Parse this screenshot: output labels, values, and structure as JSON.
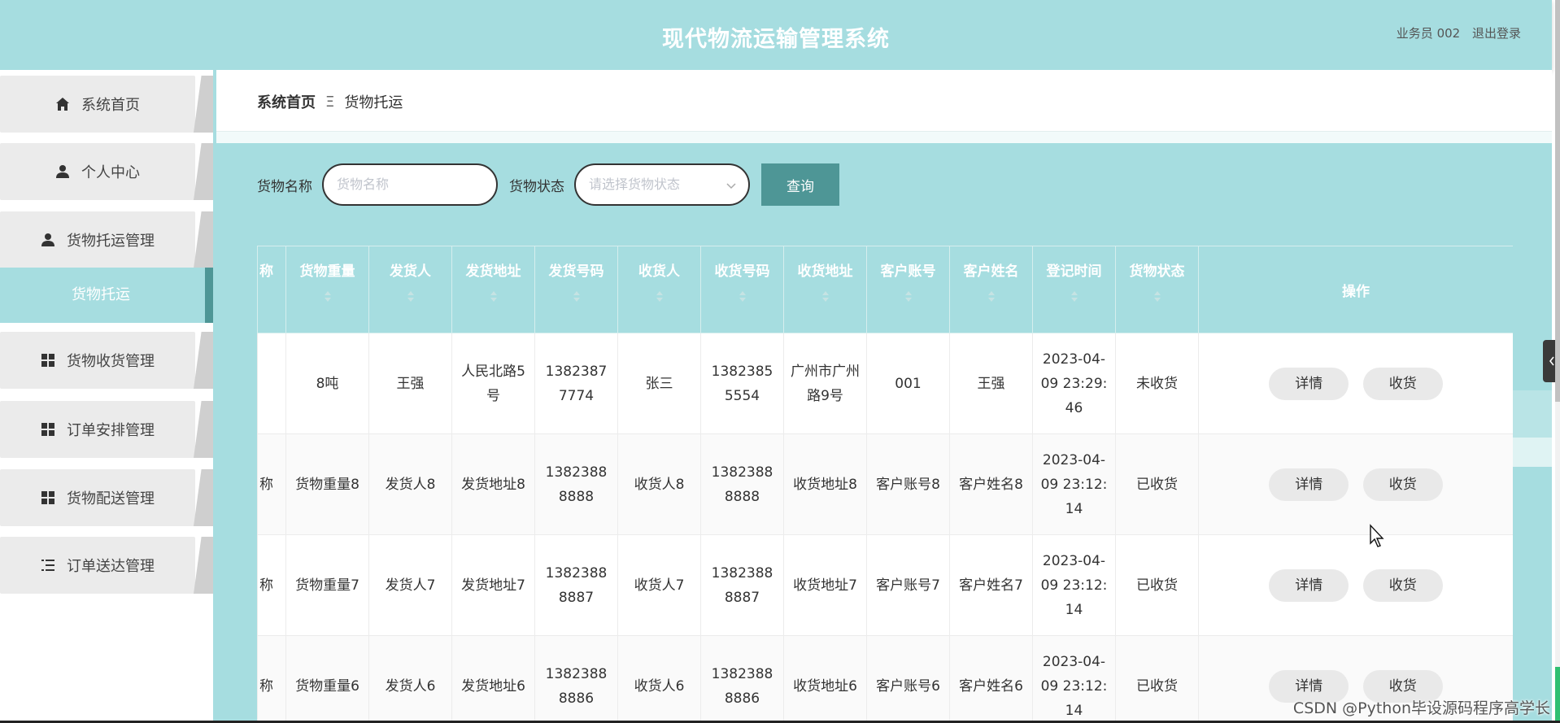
{
  "header": {
    "title": "现代物流运输管理系统",
    "user": "业务员 002",
    "logout": "退出登录"
  },
  "sidebar": {
    "items": [
      {
        "label": "系统首页",
        "icon": "home-icon"
      },
      {
        "label": "个人中心",
        "icon": "user-icon"
      },
      {
        "label": "货物托运管理",
        "icon": "user-icon"
      },
      {
        "label": "货物收货管理",
        "icon": "grid-icon"
      },
      {
        "label": "订单安排管理",
        "icon": "grid-icon"
      },
      {
        "label": "货物配送管理",
        "icon": "grid-icon"
      },
      {
        "label": "订单送达管理",
        "icon": "list-icon"
      }
    ],
    "active_sub": "货物托运"
  },
  "breadcrumb": {
    "home": "系统首页",
    "separator": "Ξ",
    "current": "货物托运"
  },
  "search": {
    "name_label": "货物名称",
    "name_placeholder": "货物名称",
    "status_label": "货物状态",
    "status_placeholder": "请选择货物状态",
    "button": "查询"
  },
  "table": {
    "headers": [
      "称",
      "货物重量",
      "发货人",
      "发货地址",
      "发货号码",
      "收货人",
      "收货号码",
      "收货地址",
      "客户账号",
      "客户姓名",
      "登记时间",
      "货物状态",
      "操作"
    ],
    "rows": [
      [
        "",
        "8吨",
        "王强",
        "人民北路5号",
        "13823877774",
        "张三",
        "13823855554",
        "广州市广州路9号",
        "001",
        "王强",
        "2023-04-09 23:29:46",
        "未收货"
      ],
      [
        "称",
        "货物重量8",
        "发货人8",
        "发货地址8",
        "13823888888",
        "收货人8",
        "13823888888",
        "收货地址8",
        "客户账号8",
        "客户姓名8",
        "2023-04-09 23:12:14",
        "已收货"
      ],
      [
        "称",
        "货物重量7",
        "发货人7",
        "发货地址7",
        "13823888887",
        "收货人7",
        "13823888887",
        "收货地址7",
        "客户账号7",
        "客户姓名7",
        "2023-04-09 23:12:14",
        "已收货"
      ],
      [
        "称",
        "货物重量6",
        "发货人6",
        "发货地址6",
        "13823888886",
        "收货人6",
        "13823888886",
        "收货地址6",
        "客户账号6",
        "客户姓名6",
        "2023-04-09 23:12:14",
        "已收货"
      ]
    ],
    "detail_button": "详情",
    "receive_button": "收货"
  },
  "watermark": "CSDN @Python毕设源码程序高学长",
  "colors": {
    "accent": "#a6dde0",
    "button": "#4e9696"
  }
}
